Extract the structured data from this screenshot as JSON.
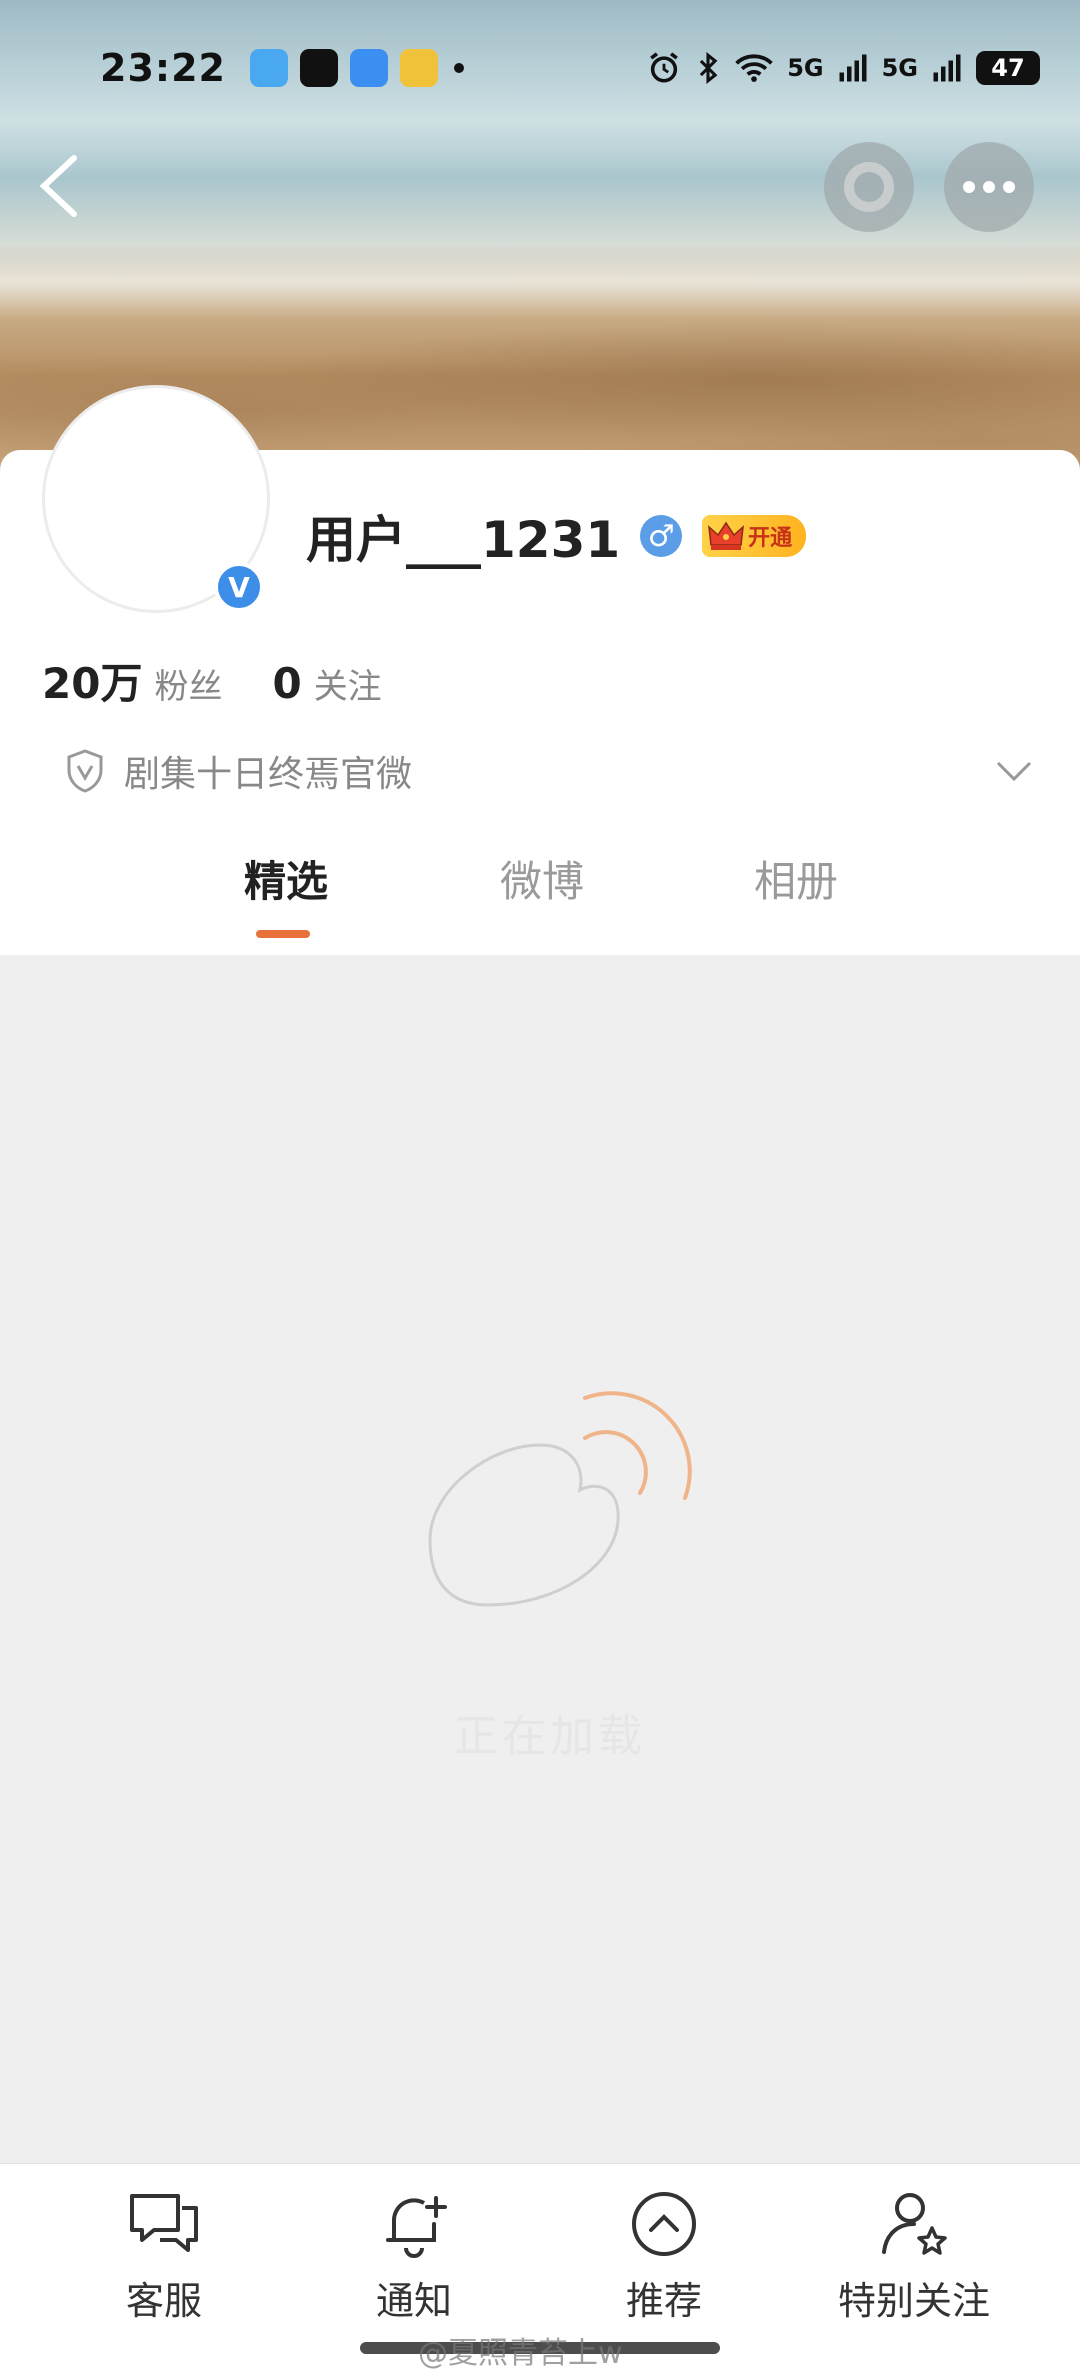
{
  "status_bar": {
    "time": "23:22",
    "signal_1": "5G",
    "signal_2": "5G",
    "battery": "47"
  },
  "profile": {
    "username": "用户___1231",
    "gender_symbol": "♂",
    "vip_label": "开通",
    "verified_symbol": "V",
    "certification": "剧集十日终焉官微"
  },
  "stats": {
    "followers_count": "20万",
    "followers_label": "粉丝",
    "following_count": "0",
    "following_label": "关注"
  },
  "tabs": [
    {
      "label": "精选",
      "active": true
    },
    {
      "label": "微博",
      "active": false
    },
    {
      "label": "相册",
      "active": false
    }
  ],
  "empty_state": {
    "text": "正在加载"
  },
  "bottom_nav": [
    {
      "label": "客服",
      "icon": "chat-bubbles-icon"
    },
    {
      "label": "通知",
      "icon": "bell-plus-icon"
    },
    {
      "label": "推荐",
      "icon": "chevron-up-circle-icon"
    },
    {
      "label": "特别关注",
      "icon": "user-star-icon"
    }
  ],
  "watermark": "@夏照青苔上w",
  "colors": {
    "accent": "#e8713a",
    "verified_blue": "#3d8ee8",
    "vip_gold": "#ffc233"
  }
}
